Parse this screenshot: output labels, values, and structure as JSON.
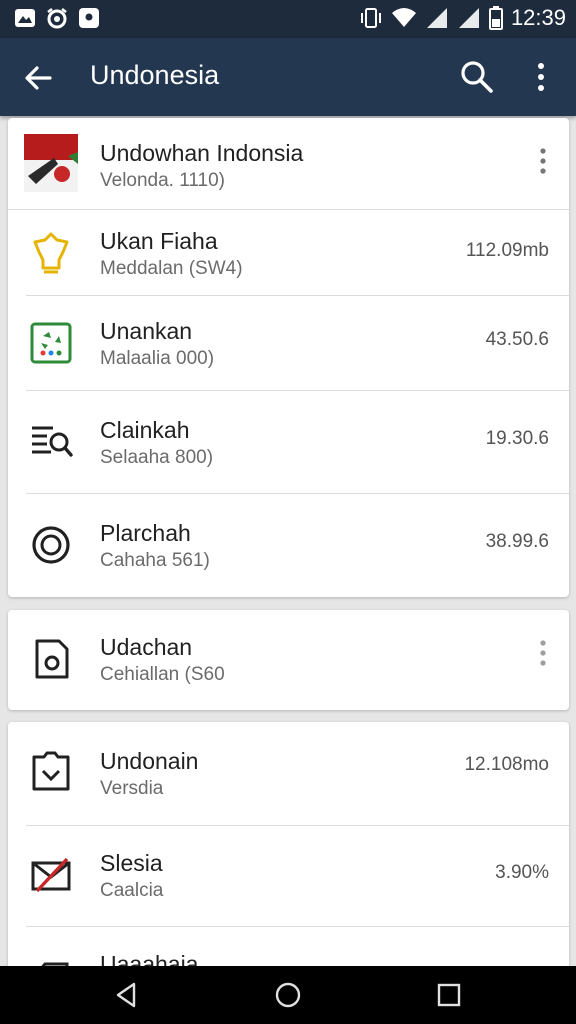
{
  "status_bar": {
    "time": "12:39",
    "left_icons": [
      "image-icon",
      "alarm-icon",
      "notification-icon"
    ],
    "right_icons": [
      "vibrate-icon",
      "wifi-icon",
      "signal-icon",
      "signal-icon",
      "battery-icon"
    ]
  },
  "app_bar": {
    "title": "Undonesia",
    "icons": [
      "back-arrow-icon",
      "search-icon",
      "overflow-menu-icon"
    ]
  },
  "card1": {
    "items": [
      {
        "title": "Undowhan Indonsia",
        "subtitle": "Velonda. 1110)",
        "value": "",
        "icon": "flag-thumbnail",
        "has_menu": true
      },
      {
        "title": "Ukan Fiaha",
        "subtitle": "Meddalan (SW4)",
        "value": "112.09mb",
        "icon": "lightbulb-icon"
      },
      {
        "title": "Unankan",
        "subtitle": "Malaalia 000)",
        "value": "43.50.6",
        "icon": "recycle-icon"
      },
      {
        "title": "Clainkah",
        "subtitle": "Selaaha 800)",
        "value": "19.30.6",
        "icon": "list-search-icon"
      },
      {
        "title": "Plarchah",
        "subtitle": "Cahaha 561)",
        "value": "38.99.6",
        "icon": "target-icon"
      }
    ]
  },
  "card2": {
    "items": [
      {
        "title": "Udachan",
        "subtitle": "Cehiallan (S60",
        "value": "",
        "icon": "camera-file-icon",
        "has_menu": true
      }
    ]
  },
  "card3": {
    "items": [
      {
        "title": "Undonain",
        "subtitle": "Versdia",
        "value": "12.108mo",
        "icon": "clipboard-check-icon"
      },
      {
        "title": "Slesia",
        "subtitle": "Caalcia",
        "value": "3.90%",
        "icon": "mail-cross-icon"
      },
      {
        "title": "Uaaahaia",
        "subtitle": "",
        "value": "",
        "icon": "tag-icon"
      }
    ]
  },
  "colors": {
    "status_bar": "#1d2b3c",
    "app_bar": "#233850",
    "background": "#e6e6e6",
    "card": "#ffffff",
    "accent_yellow": "#e6b400",
    "accent_green": "#2e8b3a",
    "accent_red": "#c62828"
  },
  "nav_bar": {
    "icons": [
      "back-triangle-icon",
      "home-circle-icon",
      "recents-square-icon"
    ]
  }
}
